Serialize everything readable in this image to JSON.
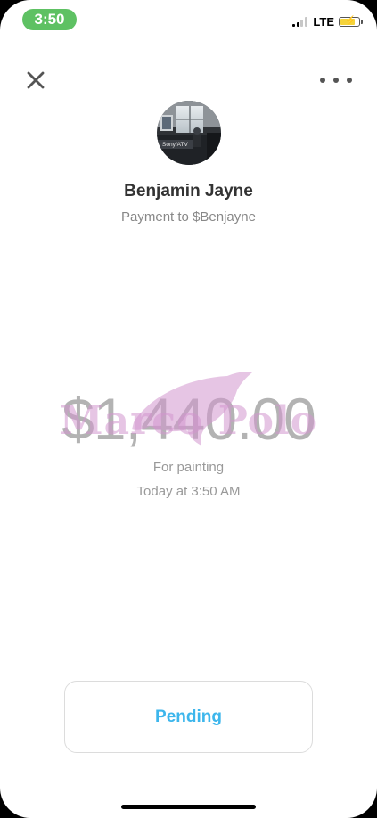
{
  "status_bar": {
    "time": "3:50",
    "network": "LTE",
    "time_pill_color": "#5ec163",
    "battery_color": "#f5d33a",
    "signal_bars_active": 2,
    "signal_bars_total": 4
  },
  "header": {
    "close_icon": "close-icon",
    "more_icon": "more-options-icon"
  },
  "recipient": {
    "name": "Benjamin Jayne",
    "subtitle": "Payment to $Benjayne",
    "avatar_caption": "Sony/ATV"
  },
  "payment": {
    "amount": "$1,440.00",
    "note": "For painting",
    "date": "Today at 3:50 AM"
  },
  "watermark": {
    "text": "Marco Polo",
    "color": "#d296cd"
  },
  "status": {
    "label": "Pending",
    "color": "#3db6ec"
  }
}
